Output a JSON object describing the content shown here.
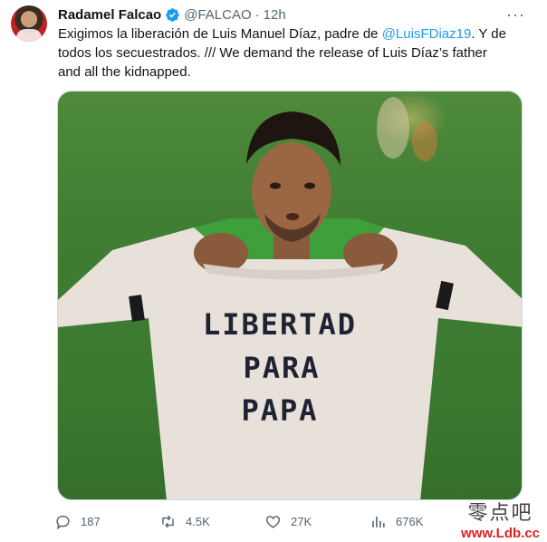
{
  "tweet": {
    "author_name": "Radamel Falcao",
    "handle": "@FALCAO",
    "separator": "·",
    "time": "12h",
    "more_label": "···",
    "text_part1": "Exigimos la liberación de Luis Manuel Díaz, padre de ",
    "mention": "@LuisFDiaz19",
    "text_part2": ". Y de todos los secuestrados. /// We demand the release of Luis Díaz’s father and all the kidnapped.",
    "verified_color": "#1d9bf0",
    "link_color": "#1d9bf0"
  },
  "media": {
    "shirt_lines": [
      "LIBERTAD",
      "PARA",
      "PAPA"
    ]
  },
  "actions": {
    "reply_count": "187",
    "retweet_count": "4.5K",
    "like_count": "27K",
    "views_count": "676K",
    "icons": [
      "reply-icon",
      "retweet-icon",
      "like-icon",
      "views-icon"
    ]
  },
  "watermark": {
    "chinese": "零点吧",
    "url": "www.Ldb.cc"
  }
}
